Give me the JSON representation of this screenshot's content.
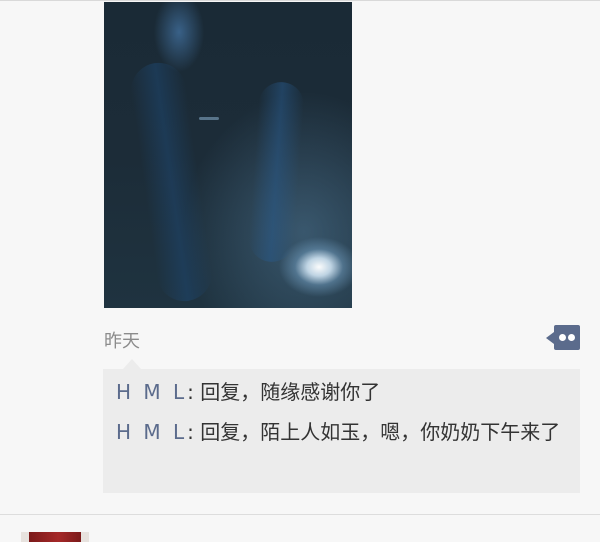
{
  "post": {
    "timestamp": "昨天",
    "image_icon": "photo-image"
  },
  "actions": {
    "comment_icon": "comment-icon"
  },
  "comments": [
    {
      "author": "H M L",
      "separator": ": ",
      "text": "回复，随缘感谢你了"
    },
    {
      "author": "H M L",
      "separator": ": ",
      "text": "回复，陌上人如玉，嗯，你奶奶下午来了"
    }
  ],
  "colors": {
    "page_background": "#f7f7f7",
    "comment_background": "#ececec",
    "author_name": "#5b6b8c",
    "comment_button": "#5b6b8c",
    "timestamp": "#8c8c8c"
  }
}
